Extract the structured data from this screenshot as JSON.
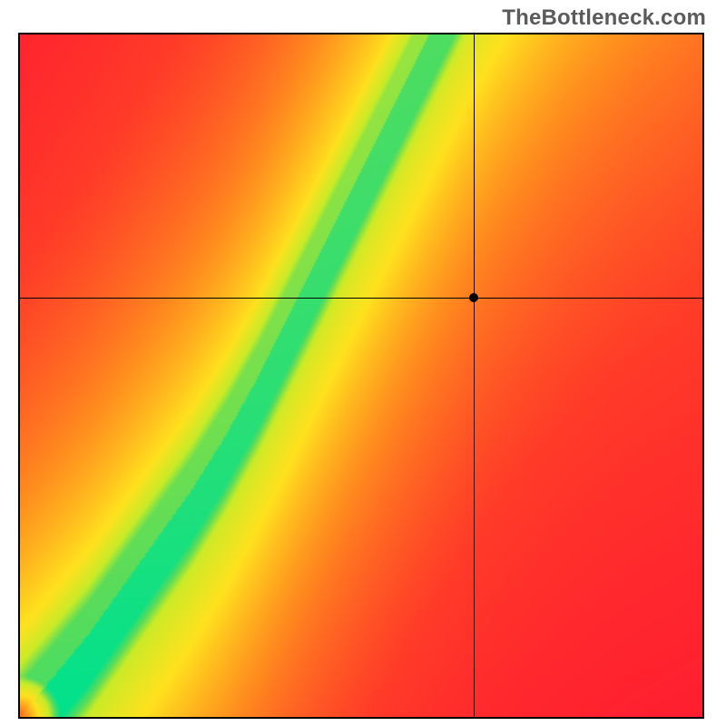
{
  "watermark": "TheBottleneck.com",
  "chart_data": {
    "type": "heatmap",
    "title": "",
    "xlabel": "",
    "ylabel": "",
    "xlim": [
      0,
      1
    ],
    "ylim": [
      0,
      1
    ],
    "crosshair": {
      "x": 0.665,
      "y": 0.615
    },
    "color_scale_note": "0=red, 0.5=yellow, 1=green; value represents match quality",
    "optimal_curve_note": "Green ridge is the optimal y for each x; listed as (x, y_optimal) samples",
    "optimal_curve": [
      [
        0.0,
        0.0
      ],
      [
        0.05,
        0.06
      ],
      [
        0.1,
        0.12
      ],
      [
        0.15,
        0.19
      ],
      [
        0.2,
        0.26
      ],
      [
        0.25,
        0.33
      ],
      [
        0.3,
        0.41
      ],
      [
        0.35,
        0.5
      ],
      [
        0.4,
        0.6
      ],
      [
        0.45,
        0.7
      ],
      [
        0.5,
        0.8
      ],
      [
        0.55,
        0.9
      ],
      [
        0.6,
        1.0
      ],
      [
        0.65,
        1.1
      ],
      [
        0.7,
        1.19
      ],
      [
        0.75,
        1.27
      ],
      [
        0.8,
        1.35
      ],
      [
        0.85,
        1.42
      ],
      [
        0.9,
        1.49
      ],
      [
        0.95,
        1.55
      ],
      [
        1.0,
        1.62
      ]
    ],
    "ridge_halfwidth": 0.045,
    "transition_halfwidth": 0.075,
    "corner_colors": {
      "top_left": "red",
      "top_right": "yellow",
      "bottom_left": "red_dark",
      "bottom_right": "red"
    }
  }
}
